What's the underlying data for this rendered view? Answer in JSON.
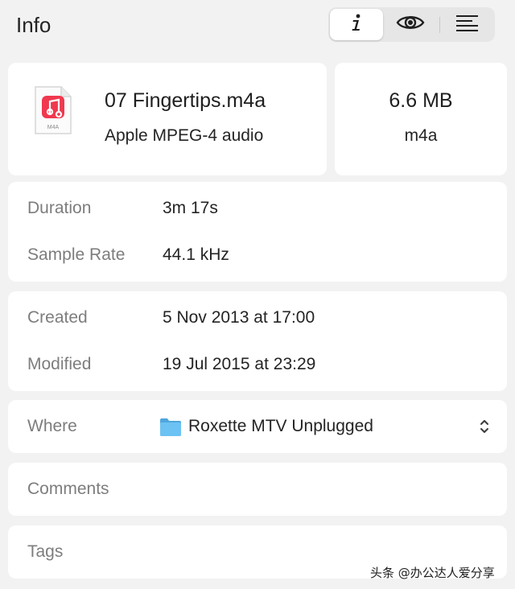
{
  "header": {
    "title": "Info",
    "segments": [
      {
        "icon": "info-icon",
        "active": true
      },
      {
        "icon": "eye-icon",
        "active": false
      },
      {
        "icon": "text-lines-icon",
        "active": false
      }
    ]
  },
  "file": {
    "name": "07 Fingertips.m4a",
    "kind": "Apple MPEG-4 audio",
    "icon_label": "M4A",
    "size": "6.6 MB",
    "extension": "m4a"
  },
  "media": {
    "duration_label": "Duration",
    "duration_value": "3m 17s",
    "sample_rate_label": "Sample Rate",
    "sample_rate_value": "44.1 kHz"
  },
  "dates": {
    "created_label": "Created",
    "created_value": "5 Nov 2013 at 17:00",
    "modified_label": "Modified",
    "modified_value": "19 Jul 2015 at 23:29"
  },
  "where": {
    "label": "Where",
    "value": "Roxette MTV Unplugged"
  },
  "comments": {
    "label": "Comments"
  },
  "tags": {
    "label": "Tags"
  },
  "watermark": "头条 @办公达人爱分享",
  "colors": {
    "background": "#f2f2f2",
    "card": "#ffffff",
    "label_gray": "#7d7d7d",
    "music_red": "#f0384e",
    "folder_blue": "#5cb9f0"
  }
}
